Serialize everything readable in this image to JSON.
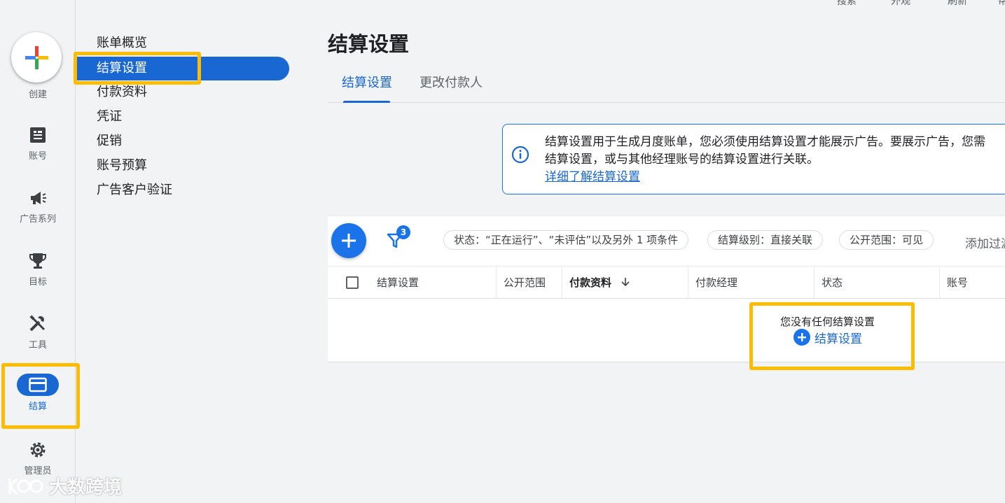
{
  "topbar": {
    "items": [
      "搜索",
      "外观",
      "刷新",
      "帮"
    ]
  },
  "rail": {
    "create_label": "创建",
    "items": [
      {
        "label": "账号",
        "icon": "account-icon"
      },
      {
        "label": "广告系列",
        "icon": "megaphone-icon"
      },
      {
        "label": "目标",
        "icon": "trophy-icon"
      },
      {
        "label": "工具",
        "icon": "tools-icon"
      },
      {
        "label": "结算",
        "icon": "billing-card-icon",
        "active": true
      },
      {
        "label": "管理员",
        "icon": "gear-icon"
      }
    ]
  },
  "subnav": {
    "items": [
      "账单概览",
      "结算设置",
      "付款资料",
      "凭证",
      "促销",
      "账号预算",
      "广告客户验证"
    ],
    "active_index": 1
  },
  "main": {
    "title": "结算设置",
    "tabs": [
      {
        "label": "结算设置",
        "active": true
      },
      {
        "label": "更改付款人",
        "active": false
      }
    ],
    "info": {
      "line1": "结算设置用于生成月度账单，您必须使用结算设置才能展示广告。要展示广告，您需",
      "line2": "结算设置，或与其他经理账号的结算设置进行关联。",
      "link": "详细了解结算设置"
    },
    "toolbar": {
      "filter_count": "3",
      "chips": [
        "状态：“正在运行”、“未评估”以及另外 1 项条件",
        "结算级别：直接关联",
        "公开范围：可见"
      ],
      "add_filter": "添加过滤"
    },
    "table": {
      "columns": [
        "结算设置",
        "公开范围",
        "付款资料",
        "付款经理",
        "状态",
        "账号"
      ],
      "sorted_column": "付款资料",
      "empty_message": "您没有任何结算设置",
      "empty_action": "结算设置"
    }
  },
  "watermark": {
    "text": "大数跨境"
  },
  "colors": {
    "accent": "#1967d2",
    "highlight": "#fbbc04"
  }
}
